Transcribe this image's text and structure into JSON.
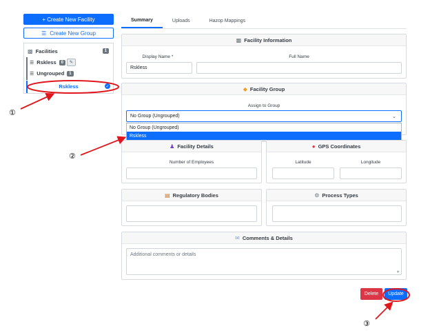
{
  "sidebar": {
    "create_facility_label": "+ Create New Facility",
    "create_group_label": "Create New Group",
    "facilities_label": "Facilities",
    "facilities_count": "1",
    "group_rskless_label": "Rskless",
    "group_rskless_count": "0",
    "ungrouped_label": "Ungrouped",
    "ungrouped_count": "1",
    "selected_facility_label": "Rskless"
  },
  "tabs": [
    "Summary",
    "Uploads",
    "Hazop Mappings"
  ],
  "facility_info": {
    "title": "Facility Information",
    "display_name_label": "Display Name *",
    "full_name_label": "Full Name",
    "display_name_value": "Rskless",
    "full_name_value": ""
  },
  "facility_group": {
    "title": "Facility Group",
    "assign_label": "Assign to Group",
    "selected_value": "No Group (Ungrouped)",
    "options": [
      "No Group (Ungrouped)",
      "Rskless"
    ]
  },
  "facility_details": {
    "title": "Facility Details",
    "employees_label": "Number of Employees"
  },
  "gps": {
    "title": "GPS Coordinates",
    "latitude_label": "Latitude",
    "longitude_label": "Longitude"
  },
  "regulatory": {
    "title": "Regulatory Bodies"
  },
  "process_types": {
    "title": "Process Types"
  },
  "comments": {
    "title": "Comments & Details",
    "placeholder": "Additional comments or details"
  },
  "actions": {
    "delete_label": "Delete",
    "update_label": "Update"
  },
  "annotations": [
    "①",
    "②",
    "③"
  ],
  "colors": {
    "primary": "#0d6efd",
    "danger": "#dc3545",
    "annotation_red": "#e0161c"
  }
}
